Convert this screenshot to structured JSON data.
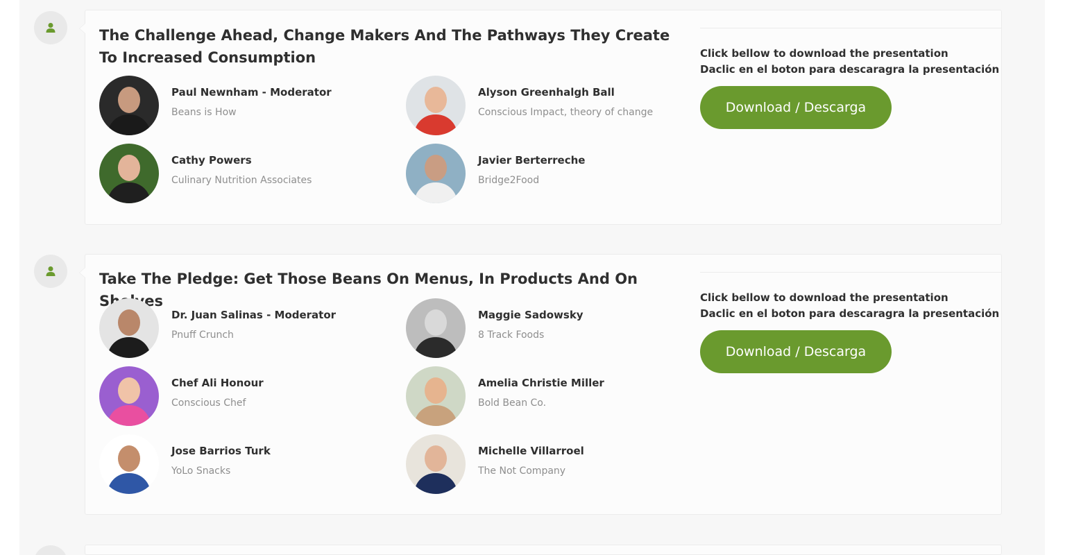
{
  "sessions": [
    {
      "title": "The Challenge Ahead, Change Makers And The Pathways They Create To Increased Consumption",
      "speakers": [
        {
          "name": "Paul Newnham - Moderator",
          "org": "Beans is How",
          "bg": "#2a2a2a",
          "skin": "#c79a7f",
          "shirt": "#1a1a1a"
        },
        {
          "name": "Alyson Greenhalgh Ball",
          "org": "Conscious Impact, theory of change",
          "bg": "#dfe3e6",
          "skin": "#e8b899",
          "shirt": "#d93a2f"
        },
        {
          "name": "Cathy Powers",
          "org": "Culinary Nutrition Associates",
          "bg": "#3f6a2c",
          "skin": "#e3b49a",
          "shirt": "#1f1f1f"
        },
        {
          "name": "Javier Berterreche",
          "org": "Bridge2Food",
          "bg": "#8fb0c4",
          "skin": "#c99d83",
          "shirt": "#f0f0f0"
        }
      ],
      "download": {
        "line1": "Click bellow to download the presentation",
        "line2": "Daclic en el boton para descaragra la presentación",
        "button": "Download / Descarga"
      }
    },
    {
      "title": "Take The Pledge: Get Those Beans On Menus, In Products And On Shelves",
      "speakers": [
        {
          "name": "Dr. Juan Salinas - Moderator",
          "org": "Pnuff Crunch",
          "bg": "#e4e4e4",
          "skin": "#b9876a",
          "shirt": "#1c1c1c"
        },
        {
          "name": "Maggie Sadowsky",
          "org": "8 Track Foods",
          "bg": "#bdbdbd",
          "skin": "#d9d9d9",
          "shirt": "#2b2b2b"
        },
        {
          "name": "Chef Ali Honour",
          "org": "Conscious Chef",
          "bg": "#9a5fd0",
          "skin": "#f0c3a8",
          "shirt": "#e94fa0"
        },
        {
          "name": "Amelia Christie Miller",
          "org": "Bold Bean Co.",
          "bg": "#cfd8c6",
          "skin": "#e6b48f",
          "shirt": "#c8a27d"
        },
        {
          "name": "Jose Barrios Turk",
          "org": "YoLo Snacks",
          "bg": "#ffffff",
          "skin": "#c48e6c",
          "shirt": "#2f57a6"
        },
        {
          "name": "Michelle Villarroel",
          "org": "The Not Company",
          "bg": "#e8e4dc",
          "skin": "#e2b599",
          "shirt": "#1e2f5c"
        }
      ],
      "download": {
        "line1": "Click bellow to download the presentation",
        "line2": "Daclic en el boton para descaragra la presentación",
        "button": "Download / Descarga"
      }
    }
  ],
  "colors": {
    "accent": "#6a9a2e",
    "user_icon": "#6a9a2e"
  },
  "icons": {
    "timeline": "user-icon"
  }
}
